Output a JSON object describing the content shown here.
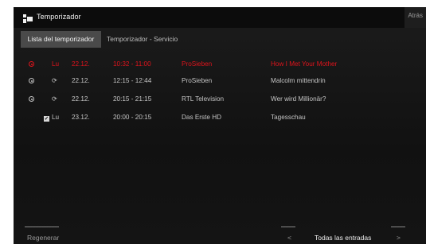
{
  "header": {
    "title": "Temporizador",
    "back_label": "Atrás"
  },
  "tabs": [
    {
      "label": "Lista del temporizador",
      "active": true
    },
    {
      "label": "Temporizador - Servicio",
      "active": false
    }
  ],
  "timers": [
    {
      "status_icon": "record-dot-icon",
      "day": "Lu",
      "date": "22.12.",
      "time": "10:32 - 11:00",
      "channel": "ProSieben",
      "program": "How I Met Your Mother",
      "highlight": true
    },
    {
      "status_icon": "record-dot-icon",
      "day_icon": "series-recording-icon",
      "day": "",
      "date": "22.12.",
      "time": "12:15 - 12:44",
      "channel": "ProSieben",
      "program": "Malcolm mittendrin",
      "highlight": false
    },
    {
      "status_icon": "record-dot-icon",
      "day_icon": "series-recording-icon",
      "day": "",
      "date": "22.12.",
      "time": "20:15 - 21:15",
      "channel": "RTL Television",
      "program": "Wer wird Millionär?",
      "highlight": false
    },
    {
      "status_icon": "checkbox-checked-icon",
      "day": "Lu",
      "date": "23.12.",
      "time": "20:00 - 20:15",
      "channel": "Das Erste HD",
      "program": "Tagesschau",
      "highlight": false
    }
  ],
  "footer": {
    "left_label": "Regenerar",
    "prev_label": "<",
    "center_label": "Todas las entradas",
    "next_label": ">"
  },
  "colors": {
    "highlight": "#e0141c",
    "text": "#c4c4c4",
    "background": "#141414",
    "active_tab": "#4a4a4a"
  }
}
